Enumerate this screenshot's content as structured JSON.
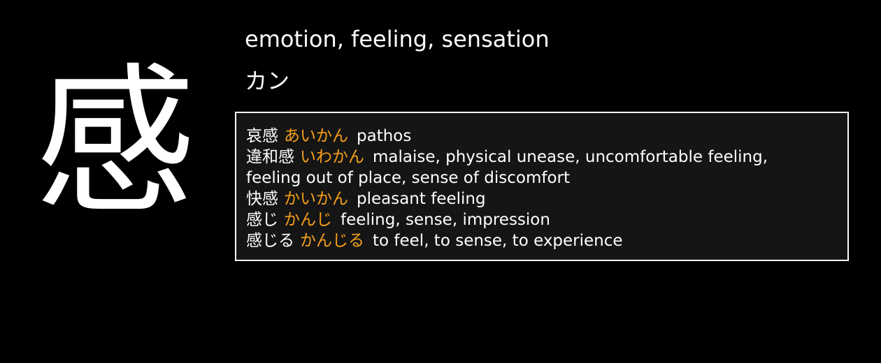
{
  "colors": {
    "background": "#000000",
    "text": "#ffffff",
    "kana_accent": "#f5a01a",
    "box_background": "#151515",
    "box_border": "#ffffff"
  },
  "kanji": "感",
  "meaning": "emotion, feeling, sensation",
  "reading": "カン",
  "vocabulary": [
    {
      "word": "哀感",
      "kana": "あいかん",
      "gloss": "pathos"
    },
    {
      "word": "違和感",
      "kana": "いわかん",
      "gloss": "malaise, physical unease, uncomfortable feeling,"
    },
    {
      "continuation": "feeling out of place, sense of discomfort"
    },
    {
      "word": "快感",
      "kana": "かいかん",
      "gloss": "pleasant feeling"
    },
    {
      "word": "感じ",
      "kana": "かんじ",
      "gloss": "feeling, sense, impression"
    },
    {
      "word": "感じる",
      "kana": "かんじる",
      "gloss": "to feel, to sense, to experience"
    }
  ]
}
